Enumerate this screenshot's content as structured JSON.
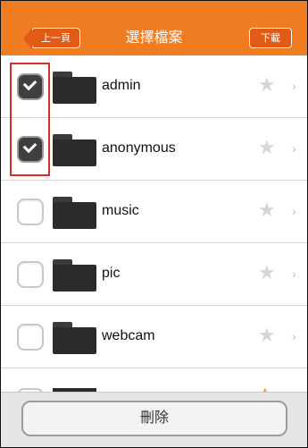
{
  "header": {
    "back_label": "上一頁",
    "title": "選擇檔案",
    "download_label": "下載"
  },
  "files": [
    {
      "name": "admin",
      "checked": true
    },
    {
      "name": "anonymous",
      "checked": true
    },
    {
      "name": "music",
      "checked": false
    },
    {
      "name": "pic",
      "checked": false
    },
    {
      "name": "webcam",
      "checked": false
    }
  ],
  "footer": {
    "delete_label": "刪除"
  },
  "icons": {
    "favorite": "star-icon",
    "folder": "folder-icon",
    "check": "checkbox-icon",
    "chevron": "chevron-right-icon"
  },
  "colors": {
    "header_bg": "#f07c22",
    "button_bg": "#e15a16",
    "highlight": "#e02a2a"
  }
}
